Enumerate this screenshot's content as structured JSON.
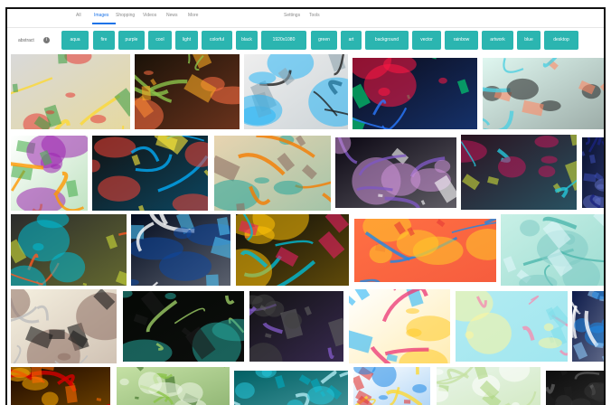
{
  "nav": {
    "tabs": [
      {
        "label": "All",
        "active": false
      },
      {
        "label": "Images",
        "active": true
      },
      {
        "label": "Shopping",
        "active": false
      },
      {
        "label": "Videos",
        "active": false
      },
      {
        "label": "News",
        "active": false
      },
      {
        "label": "More",
        "active": false
      },
      {
        "label": "Settings",
        "active": false
      },
      {
        "label": "Tools",
        "active": false
      }
    ]
  },
  "search": {
    "query": "abstract"
  },
  "chips": [
    "aqua",
    "fire",
    "purple",
    "cool",
    "light",
    "colorful",
    "black",
    "1920x1080",
    "green",
    "art",
    "background",
    "vector",
    "rainbow",
    "artwork",
    "blue",
    "desktop"
  ],
  "colors": {
    "chip_bg": "#2bb5b0",
    "active_tab": "#1a73e8",
    "frame_border": "#111111"
  },
  "images": [
    {
      "name": "colorful-cubes-wave",
      "colors": [
        "#d9d9d9",
        "#e53935",
        "#43a047",
        "#fdd835"
      ]
    },
    {
      "name": "glowing-neon-splash-dark",
      "colors": [
        "#1a1208",
        "#f9a825",
        "#8bc34a",
        "#ff7043"
      ]
    },
    {
      "name": "black-blue-ink-splatter",
      "colors": [
        "#eeeeee",
        "#212121",
        "#29b6f6",
        "#90a4ae"
      ]
    },
    {
      "name": "rainbow-bokeh-dark",
      "colors": [
        "#0b0b1a",
        "#ff1744",
        "#00e676",
        "#2979ff"
      ]
    },
    {
      "name": "swirl-ribbon-light",
      "colors": [
        "#dff7f0",
        "#ff8a65",
        "#4dd0e1",
        "#212121"
      ]
    },
    {
      "name": "rainbow-squares-white",
      "colors": [
        "#ffffff",
        "#ff9800",
        "#9c27b0",
        "#4caf50"
      ]
    },
    {
      "name": "rainbow-city-splash",
      "colors": [
        "#111111",
        "#f44336",
        "#ffeb3b",
        "#03a9f4"
      ]
    },
    {
      "name": "beige-paint-splash",
      "colors": [
        "#e8d4b0",
        "#8d6e63",
        "#f57c00",
        "#26a69a"
      ]
    },
    {
      "name": "purple-light-streaks",
      "colors": [
        "#0a0612",
        "#7e57c2",
        "#ce93d8",
        "#ffffff"
      ]
    },
    {
      "name": "dark-paint-strokes",
      "colors": [
        "#2a1320",
        "#c2185b",
        "#cddc39",
        "#26c6da"
      ]
    },
    {
      "name": "dark-blue-edge",
      "colors": [
        "#0a1230",
        "#3949ab",
        "#1a237e",
        "#5c6bc0"
      ]
    },
    {
      "name": "mosaic-tiles-color",
      "colors": [
        "#2b2b2b",
        "#ff5722",
        "#00bcd4",
        "#cddc39"
      ]
    },
    {
      "name": "blue-glowing-curve",
      "colors": [
        "#020b1f",
        "#0d47a1",
        "#4fc3f7",
        "#ffffff"
      ]
    },
    {
      "name": "neon-panels-dark",
      "colors": [
        "#0b0b0b",
        "#e91e63",
        "#00bcd4",
        "#ffc107"
      ]
    },
    {
      "name": "orange-blue-waves",
      "colors": [
        "#ff7043",
        "#1e88e5",
        "#ffca28",
        "#e53935"
      ]
    },
    {
      "name": "mint-green-waves",
      "colors": [
        "#c8f0e6",
        "#80cbc4",
        "#e0f7fa",
        "#4db6ac"
      ]
    },
    {
      "name": "crowd-silhouette-party",
      "colors": [
        "#f5f0e0",
        "#1a1a1a",
        "#bdbdbd",
        "#8d6e63"
      ]
    },
    {
      "name": "dark-glowing-wave-line",
      "colors": [
        "#050805",
        "#9ccc65",
        "#26a69a",
        "#1b1b1b"
      ]
    },
    {
      "name": "dark-polygon-shards",
      "colors": [
        "#111111",
        "#424242",
        "#616161",
        "#7e57c2"
      ]
    },
    {
      "name": "floral-swirl-white",
      "colors": [
        "#ffffff",
        "#29b6f6",
        "#ec407a",
        "#ffca28"
      ]
    },
    {
      "name": "pastel-silk-waves",
      "colors": [
        "#b2ebf2",
        "#f48fb1",
        "#fff59d",
        "#80deea"
      ]
    },
    {
      "name": "blue-streaks-edge",
      "colors": [
        "#0d1b4a",
        "#1e88e5",
        "#90caf9",
        "#ffffff"
      ]
    },
    {
      "name": "fire-swirl-dark",
      "colors": [
        "#1a0600",
        "#ff6d00",
        "#d50000",
        "#ffab00"
      ]
    },
    {
      "name": "green-swirl-light",
      "colors": [
        "#c5e1a5",
        "#8bc34a",
        "#f1f8e9",
        "#33691e"
      ]
    },
    {
      "name": "teal-blue-glow",
      "colors": [
        "#006064",
        "#26c6da",
        "#00acc1",
        "#b2ebf2"
      ]
    },
    {
      "name": "diamond-shapes-color",
      "colors": [
        "#ffffff",
        "#e53935",
        "#fdd835",
        "#1e88e5"
      ]
    },
    {
      "name": "soft-green-light",
      "colors": [
        "#e8f5e9",
        "#c5e1a5",
        "#ffffff",
        "#aed581"
      ]
    },
    {
      "name": "dark-corner",
      "colors": [
        "#0d0d0d",
        "#333333",
        "#1e1e1e",
        "#5a5a5a"
      ]
    }
  ]
}
